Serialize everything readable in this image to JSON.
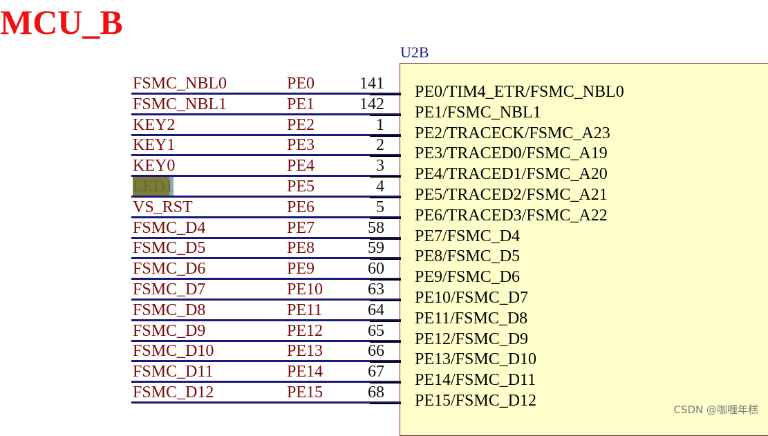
{
  "title": "MCU_B",
  "part_label": "U2B",
  "pins": [
    {
      "net": "FSMC_NBL0",
      "port": "PE0",
      "pin": "141",
      "function": "PE0/TIM4_ETR/FSMC_NBL0",
      "highlight": false
    },
    {
      "net": "FSMC_NBL1",
      "port": "PE1",
      "pin": "142",
      "function": "PE1/FSMC_NBL1",
      "highlight": false
    },
    {
      "net": "KEY2",
      "port": "PE2",
      "pin": "1",
      "function": "PE2/TRACECK/FSMC_A23",
      "highlight": false
    },
    {
      "net": "KEY1",
      "port": "PE3",
      "pin": "2",
      "function": "PE3/TRACED0/FSMC_A19",
      "highlight": false
    },
    {
      "net": "KEY0",
      "port": "PE4",
      "pin": "3",
      "function": "PE4/TRACED1/FSMC_A20",
      "highlight": false
    },
    {
      "net": "LED1",
      "port": "PE5",
      "pin": "4",
      "function": "PE5/TRACED2/FSMC_A21",
      "highlight": true
    },
    {
      "net": "VS_RST",
      "port": "PE6",
      "pin": "5",
      "function": "PE6/TRACED3/FSMC_A22",
      "highlight": false
    },
    {
      "net": "FSMC_D4",
      "port": "PE7",
      "pin": "58",
      "function": "PE7/FSMC_D4",
      "highlight": false
    },
    {
      "net": "FSMC_D5",
      "port": "PE8",
      "pin": "59",
      "function": "PE8/FSMC_D5",
      "highlight": false
    },
    {
      "net": "FSMC_D6",
      "port": "PE9",
      "pin": "60",
      "function": "PE9/FSMC_D6",
      "highlight": false
    },
    {
      "net": "FSMC_D7",
      "port": "PE10",
      "pin": "63",
      "function": "PE10/FSMC_D7",
      "highlight": false
    },
    {
      "net": "FSMC_D8",
      "port": "PE11",
      "pin": "64",
      "function": "PE11/FSMC_D8",
      "highlight": false
    },
    {
      "net": "FSMC_D9",
      "port": "PE12",
      "pin": "65",
      "function": "PE12/FSMC_D9",
      "highlight": false
    },
    {
      "net": "FSMC_D10",
      "port": "PE13",
      "pin": "66",
      "function": "PE13/FSMC_D10",
      "highlight": false
    },
    {
      "net": "FSMC_D11",
      "port": "PE14",
      "pin": "67",
      "function": "PE14/FSMC_D11",
      "highlight": false
    },
    {
      "net": "FSMC_D12",
      "port": "PE15",
      "pin": "68",
      "function": "PE15/FSMC_D12",
      "highlight": false
    }
  ],
  "watermark": "CSDN @咖喱年糕",
  "colors": {
    "title": "#ee1111",
    "net_label": "#7a0a0a",
    "wire": "#1a1a7a",
    "component_fill": "#ffffcc",
    "component_border": "#7a1b1b",
    "part_label": "#1a1a8c",
    "highlight": "#7d7d3a"
  }
}
